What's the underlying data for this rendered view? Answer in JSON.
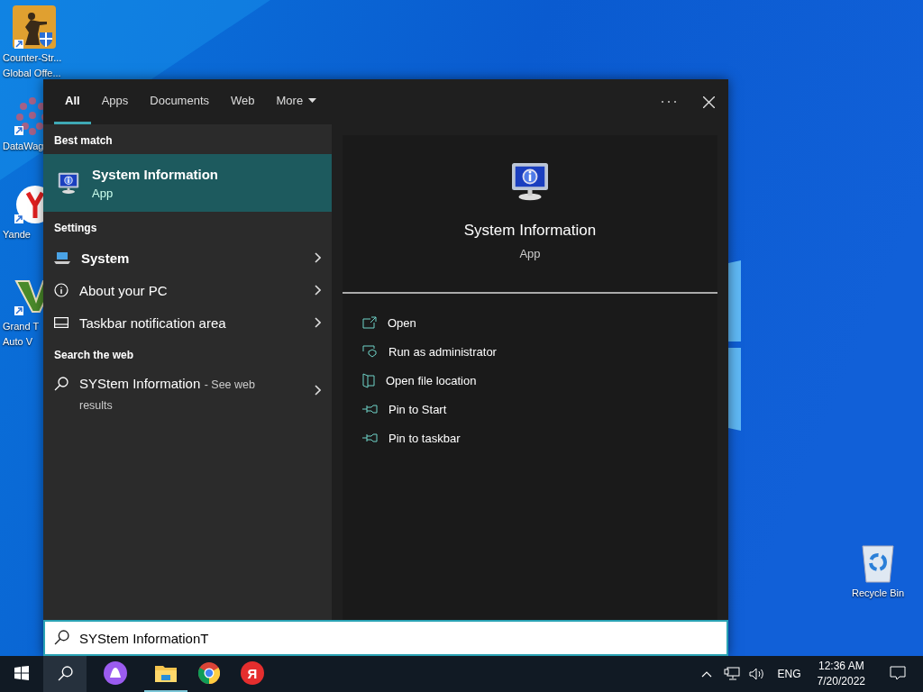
{
  "desktop_icons": [
    {
      "kind": "game",
      "lines": [
        "Counter-Str...",
        "Global Offe..."
      ]
    },
    {
      "kind": "molecule",
      "lines": [
        "DataWag"
      ]
    },
    {
      "kind": "browser",
      "lines": [
        "Yande"
      ]
    },
    {
      "kind": "emblem",
      "lines": [
        "Grand T",
        "Auto V"
      ]
    },
    {
      "kind": "bin",
      "lines": [
        "Recycle Bin"
      ]
    }
  ],
  "search_panel": {
    "tabs": [
      {
        "label": "All",
        "selected": true
      },
      {
        "label": "Apps",
        "selected": false
      },
      {
        "label": "Documents",
        "selected": false
      },
      {
        "label": "Web",
        "selected": false
      },
      {
        "label": "More",
        "selected": false
      }
    ],
    "best_match": {
      "heading": "Best match",
      "title": "System Information",
      "subtitle": "App",
      "selected": true
    },
    "settings": {
      "heading": "Settings",
      "items": [
        {
          "label": "System",
          "kind": "laptop"
        },
        {
          "label": "About your PC",
          "kind": "info"
        },
        {
          "label": "Taskbar notification area",
          "kind": "taskbar"
        }
      ]
    },
    "web": {
      "heading": "Search the web",
      "query": "SYStem Information",
      "suffix": "- See web results"
    },
    "detail": {
      "title": "System Information",
      "subtitle": "App",
      "actions": [
        {
          "label": "Open",
          "kind": "open"
        },
        {
          "label": "Run as administrator",
          "kind": "admin"
        },
        {
          "label": "Open file location",
          "kind": "folder"
        },
        {
          "label": "Pin to Start",
          "kind": "pin"
        },
        {
          "label": "Pin to taskbar",
          "kind": "pin"
        }
      ]
    },
    "search_box": {
      "value": "SYStem InformationT"
    }
  },
  "taskbar": {
    "search_active": true,
    "apps": [
      {
        "kind": "assistant",
        "running": false
      },
      {
        "kind": "explorer",
        "running": true
      },
      {
        "kind": "chrome",
        "running": false
      },
      {
        "kind": "yandex",
        "running": false,
        "label": "Я"
      }
    ],
    "language": "ENG",
    "time": "12:36 AM",
    "date": "7/20/2022"
  }
}
